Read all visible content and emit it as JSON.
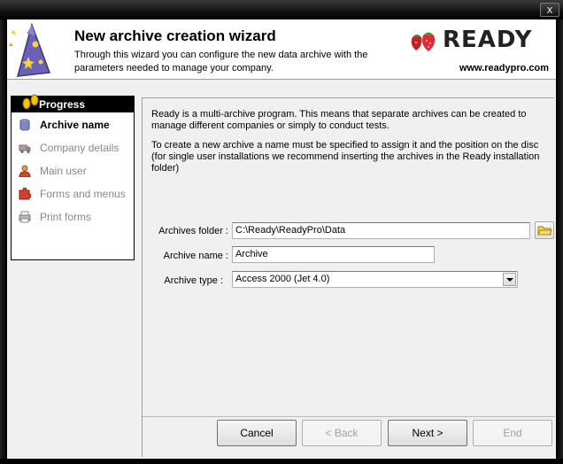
{
  "window": {
    "close_glyph": "x"
  },
  "header": {
    "title": "New archive creation wizard",
    "description": "Through this wizard you can configure the new data archive with the parameters needed to manage your company.",
    "brand": "READY",
    "url": "www.readypro.com",
    "wizard_icon": "wizard-hat-icon",
    "logo_icon": "strawberry-icon"
  },
  "progress": {
    "heading": "Progress",
    "steps": [
      {
        "label": "Archive name",
        "icon": "database-icon",
        "active": true
      },
      {
        "label": "Company details",
        "icon": "truck-icon",
        "active": false
      },
      {
        "label": "Main user",
        "icon": "user-icon",
        "active": false
      },
      {
        "label": "Forms and menus",
        "icon": "puzzle-icon",
        "active": false
      },
      {
        "label": "Print forms",
        "icon": "printer-icon",
        "active": false
      }
    ]
  },
  "main": {
    "intro": "Ready is a multi-archive program. This means that separate archives can be created to manage different companies or simply to conduct tests.",
    "instruction": "To create a new archive a name must be specified to assign it and the position on the disc (for single user installations we recommend inserting the archives in the Ready installation folder)",
    "archives_folder_label": "Archives folder :",
    "archives_folder_value": "C:\\Ready\\ReadyPro\\Data",
    "archive_name_label": "Archive name :",
    "archive_name_value": "Archive",
    "archive_type_label": "Archive type :",
    "archive_type_value": "Access 2000 (Jet 4.0)"
  },
  "buttons": {
    "cancel": "Cancel",
    "back": "< Back",
    "next": "Next >",
    "end": "End"
  },
  "colors": {
    "accent_red": "#d41e2a",
    "header_bg": "#ffffff",
    "panel_bg": "#f0f0f0"
  }
}
